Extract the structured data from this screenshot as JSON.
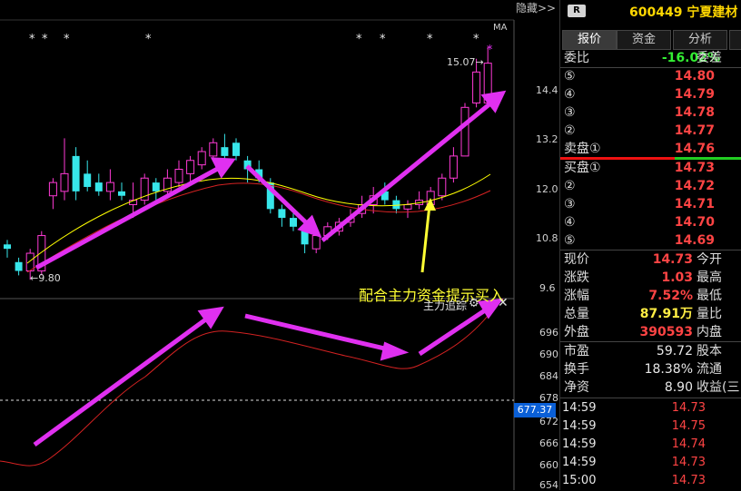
{
  "toolbar": {
    "hide_label": "隐藏>>"
  },
  "chart": {
    "ma_label": "MA",
    "y_ticks": [
      "14.4",
      "13.2",
      "12.0",
      "10.8",
      "9.6"
    ],
    "low_label": "9.80",
    "high_label": "15.07",
    "annotation": "配合主力资金提示买入"
  },
  "indicator": {
    "name": "主力追踪",
    "y_ticks": [
      "696",
      "690",
      "684",
      "678",
      "672",
      "666",
      "660",
      "654"
    ],
    "current_value": "677.37"
  },
  "stock": {
    "badge": "R",
    "code_name": "600449 宁夏建材"
  },
  "tabs": [
    "报价",
    "资金",
    "分析"
  ],
  "order_book": {
    "weibi_label": "委比",
    "weibi_value": "-16.02%",
    "weicha_label": "委差",
    "asks": [
      {
        "level": "⑤",
        "price": "14.80"
      },
      {
        "level": "④",
        "price": "14.79"
      },
      {
        "level": "③",
        "price": "14.78"
      },
      {
        "level": "②",
        "price": "14.77"
      },
      {
        "level": "卖盘①",
        "price": "14.76"
      }
    ],
    "bids": [
      {
        "level": "买盘①",
        "price": "14.73"
      },
      {
        "level": "②",
        "price": "14.72"
      },
      {
        "level": "③",
        "price": "14.71"
      },
      {
        "level": "④",
        "price": "14.70"
      },
      {
        "level": "⑤",
        "price": "14.69"
      }
    ]
  },
  "quote": [
    {
      "label": "现价",
      "value": "14.73",
      "label2": "今开"
    },
    {
      "label": "涨跌",
      "value": "1.03",
      "label2": "最高"
    },
    {
      "label": "涨幅",
      "value": "7.52%",
      "label2": "最低"
    },
    {
      "label": "总量",
      "value": "87.91万",
      "label2": "量比"
    },
    {
      "label": "外盘",
      "value": "390593",
      "label2": "内盘"
    }
  ],
  "fundamentals": [
    {
      "label": "市盈",
      "value": "59.72",
      "label2": "股本"
    },
    {
      "label": "换手",
      "value": "18.38%",
      "label2": "流通"
    },
    {
      "label": "净资",
      "value": "8.90",
      "label2": "收益(三"
    }
  ],
  "ticks": [
    {
      "time": "14:59",
      "price": "14.73"
    },
    {
      "time": "14:59",
      "price": "14.75"
    },
    {
      "time": "14:59",
      "price": "14.74"
    },
    {
      "time": "14:59",
      "price": "14.73"
    },
    {
      "time": "15:00",
      "price": "14.73"
    }
  ],
  "chart_data": {
    "type": "candlestick",
    "candles": [
      {
        "o": 10.6,
        "c": 10.5,
        "h": 10.7,
        "l": 10.3
      },
      {
        "o": 10.2,
        "c": 10.0,
        "h": 10.3,
        "l": 9.9
      },
      {
        "o": 10.0,
        "c": 10.4,
        "h": 10.5,
        "l": 9.8
      },
      {
        "o": 10.0,
        "c": 10.8,
        "h": 10.9,
        "l": 9.9
      },
      {
        "o": 11.7,
        "c": 12.0,
        "h": 12.1,
        "l": 11.4
      },
      {
        "o": 11.8,
        "c": 12.2,
        "h": 13.0,
        "l": 11.6
      },
      {
        "o": 12.6,
        "c": 11.8,
        "h": 12.8,
        "l": 11.6
      },
      {
        "o": 12.2,
        "c": 11.9,
        "h": 12.5,
        "l": 11.8
      },
      {
        "o": 12.0,
        "c": 11.8,
        "h": 12.2,
        "l": 11.7
      },
      {
        "o": 11.8,
        "c": 12.0,
        "h": 12.3,
        "l": 11.6
      },
      {
        "o": 11.8,
        "c": 11.7,
        "h": 12.0,
        "l": 11.6
      },
      {
        "o": 11.5,
        "c": 11.6,
        "h": 12.0,
        "l": 11.2
      },
      {
        "o": 11.6,
        "c": 12.1,
        "h": 12.2,
        "l": 11.5
      },
      {
        "o": 12.0,
        "c": 11.8,
        "h": 12.1,
        "l": 11.6
      },
      {
        "o": 11.8,
        "c": 12.1,
        "h": 12.3,
        "l": 11.7
      },
      {
        "o": 12.0,
        "c": 12.3,
        "h": 12.5,
        "l": 11.9
      },
      {
        "o": 12.2,
        "c": 12.5,
        "h": 12.6,
        "l": 12.0
      },
      {
        "o": 12.4,
        "c": 12.7,
        "h": 12.8,
        "l": 12.3
      },
      {
        "o": 12.6,
        "c": 12.9,
        "h": 13.0,
        "l": 12.5
      },
      {
        "o": 12.8,
        "c": 12.6,
        "h": 13.1,
        "l": 12.5
      },
      {
        "o": 12.9,
        "c": 12.6,
        "h": 13.0,
        "l": 12.5
      },
      {
        "o": 12.5,
        "c": 12.3,
        "h": 12.6,
        "l": 12.0
      },
      {
        "o": 12.3,
        "c": 12.1,
        "h": 12.5,
        "l": 12.0
      },
      {
        "o": 12.0,
        "c": 11.4,
        "h": 12.1,
        "l": 11.3
      },
      {
        "o": 11.4,
        "c": 11.2,
        "h": 11.5,
        "l": 11.0
      },
      {
        "o": 11.2,
        "c": 11.0,
        "h": 11.3,
        "l": 10.9
      },
      {
        "o": 10.9,
        "c": 10.6,
        "h": 11.0,
        "l": 10.4
      },
      {
        "o": 10.5,
        "c": 10.8,
        "h": 10.9,
        "l": 10.4
      },
      {
        "o": 10.8,
        "c": 11.0,
        "h": 11.1,
        "l": 10.7
      },
      {
        "o": 10.9,
        "c": 11.1,
        "h": 11.2,
        "l": 10.8
      },
      {
        "o": 11.1,
        "c": 11.2,
        "h": 11.4,
        "l": 11.0
      },
      {
        "o": 11.3,
        "c": 11.5,
        "h": 11.7,
        "l": 11.2
      },
      {
        "o": 11.5,
        "c": 11.7,
        "h": 11.9,
        "l": 11.3
      },
      {
        "o": 11.8,
        "c": 11.6,
        "h": 12.0,
        "l": 11.5
      },
      {
        "o": 11.6,
        "c": 11.4,
        "h": 11.7,
        "l": 11.3
      },
      {
        "o": 11.4,
        "c": 11.5,
        "h": 11.6,
        "l": 11.2
      },
      {
        "o": 11.5,
        "c": 11.6,
        "h": 11.8,
        "l": 11.4
      },
      {
        "o": 11.5,
        "c": 11.8,
        "h": 11.9,
        "l": 11.4
      },
      {
        "o": 11.7,
        "c": 12.1,
        "h": 12.2,
        "l": 11.6
      },
      {
        "o": 12.1,
        "c": 12.6,
        "h": 12.8,
        "l": 12.0
      },
      {
        "o": 12.6,
        "c": 13.7,
        "h": 13.8,
        "l": 12.6
      },
      {
        "o": 13.8,
        "c": 14.5,
        "h": 14.8,
        "l": 13.7
      },
      {
        "o": 13.8,
        "c": 14.7,
        "h": 15.07,
        "l": 13.7
      }
    ],
    "ylim": [
      9.6,
      15.0
    ]
  }
}
